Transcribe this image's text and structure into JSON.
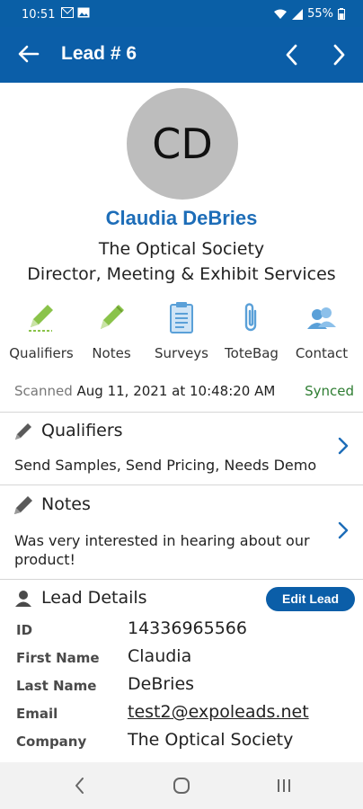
{
  "status_bar": {
    "time": "10:51",
    "battery": "55%"
  },
  "header": {
    "title": "Lead # 6"
  },
  "profile": {
    "initials": "CD",
    "name": "Claudia DeBries",
    "company": "The Optical Society",
    "job_title": "Director, Meeting & Exhibit Services"
  },
  "actions": [
    {
      "label": "Qualifiers",
      "icon": "pencil-icon",
      "color": "#8ac34a"
    },
    {
      "label": "Notes",
      "icon": "pencil-icon",
      "color": "#8ac34a"
    },
    {
      "label": "Surveys",
      "icon": "clipboard-icon",
      "color": "#5aa0d8"
    },
    {
      "label": "ToteBag",
      "icon": "paperclip-icon",
      "color": "#5aa0d8"
    },
    {
      "label": "Contact",
      "icon": "contacts-icon",
      "color": "#5aa0d8"
    }
  ],
  "scan": {
    "label": "Scanned",
    "value": "Aug 11, 2021 at 10:48:20 AM",
    "status": "Synced"
  },
  "qualifiers": {
    "title": "Qualifiers",
    "text": "Send Samples, Send Pricing, Needs Demo"
  },
  "notes": {
    "title": "Notes",
    "text_line1": "Was very interested in hearing about our",
    "text_line2": "product!"
  },
  "lead_details": {
    "title": "Lead Details",
    "edit_label": "Edit Lead",
    "rows": [
      {
        "label": "ID",
        "value": "14336965566"
      },
      {
        "label": "First Name",
        "value": "Claudia"
      },
      {
        "label": "Last Name",
        "value": "DeBries"
      },
      {
        "label": "Email",
        "value": "test2@expoleads.net"
      },
      {
        "label": "Company",
        "value": "The Optical Society"
      }
    ]
  },
  "colors": {
    "primary": "#0b5ea8",
    "accent_blue": "#1d6db8",
    "synced_green": "#2e7d32"
  }
}
